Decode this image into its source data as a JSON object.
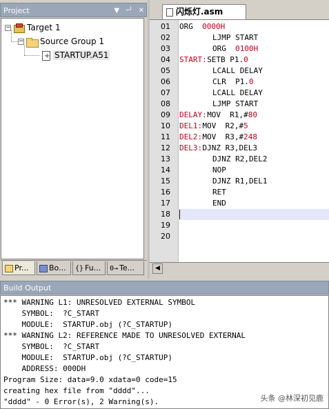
{
  "project_panel": {
    "title": "Project",
    "controls": {
      "dropdown": "▼",
      "pin": "ᆔ",
      "close": "✕"
    },
    "tree": {
      "target": "Target 1",
      "group": "Source Group 1",
      "file": "STARTUP.A51"
    },
    "tabs": [
      {
        "label": "Pr...",
        "icon": "project-icon"
      },
      {
        "label": "Bo...",
        "icon": "books-icon"
      },
      {
        "label": "Fu...",
        "icon": "functions-icon",
        "glyph": "{}"
      },
      {
        "label": "Te...",
        "icon": "templates-icon",
        "glyph": "0→"
      }
    ]
  },
  "editor": {
    "tab_title": "闪烁灯.asm",
    "lines": [
      {
        "num": "01",
        "label": "",
        "code": "ORG  ",
        "arg": "0000H"
      },
      {
        "num": "02",
        "label": "",
        "code": "LJMP START",
        "arg": ""
      },
      {
        "num": "03",
        "label": "",
        "code": "ORG  ",
        "arg": "0100H"
      },
      {
        "num": "04",
        "label": "START:",
        "code": "SETB P1.",
        "arg": "0"
      },
      {
        "num": "05",
        "label": "",
        "code": "LCALL DELAY",
        "arg": ""
      },
      {
        "num": "06",
        "label": "",
        "code": "CLR  P1.",
        "arg": "0"
      },
      {
        "num": "07",
        "label": "",
        "code": "LCALL DELAY",
        "arg": ""
      },
      {
        "num": "08",
        "label": "",
        "code": "LJMP START",
        "arg": ""
      },
      {
        "num": "09",
        "label": "DELAY:",
        "code": "MOV  R1,#",
        "arg": "80"
      },
      {
        "num": "10",
        "label": "DEL1:",
        "code": "MOV  R2,#",
        "arg": "5"
      },
      {
        "num": "11",
        "label": "DEL2:",
        "code": "MOV  R3,#",
        "arg": "248"
      },
      {
        "num": "12",
        "label": "DEL3:",
        "code": "DJNZ R3,DEL3",
        "arg": ""
      },
      {
        "num": "13",
        "label": "",
        "code": "DJNZ R2,DEL2",
        "arg": ""
      },
      {
        "num": "14",
        "label": "",
        "code": "NOP",
        "arg": ""
      },
      {
        "num": "15",
        "label": "",
        "code": "DJNZ R1,DEL1",
        "arg": ""
      },
      {
        "num": "16",
        "label": "",
        "code": "RET",
        "arg": ""
      },
      {
        "num": "17",
        "label": "",
        "code": "END",
        "arg": ""
      },
      {
        "num": "18",
        "label": "",
        "code": "",
        "arg": ""
      },
      {
        "num": "19",
        "label": "",
        "code": "",
        "arg": ""
      },
      {
        "num": "20",
        "label": "",
        "code": "",
        "arg": ""
      }
    ],
    "hscroll_left": "◀"
  },
  "build_output": {
    "title": "Build Output",
    "lines": [
      "*** WARNING L1: UNRESOLVED EXTERNAL SYMBOL",
      "    SYMBOL:  ?C_START",
      "    MODULE:  STARTUP.obj (?C_STARTUP)",
      "*** WARNING L2: REFERENCE MADE TO UNRESOLVED EXTERNAL",
      "    SYMBOL:  ?C_START",
      "    MODULE:  STARTUP.obj (?C_STARTUP)",
      "    ADDRESS: 000DH",
      "Program Size: data=9.0 xdata=0 code=15",
      "creating hex file from \"dddd\"...",
      "\"dddd\" - 0 Error(s), 2 Warning(s)."
    ],
    "watermark": "头条 @林深初见鹿"
  }
}
